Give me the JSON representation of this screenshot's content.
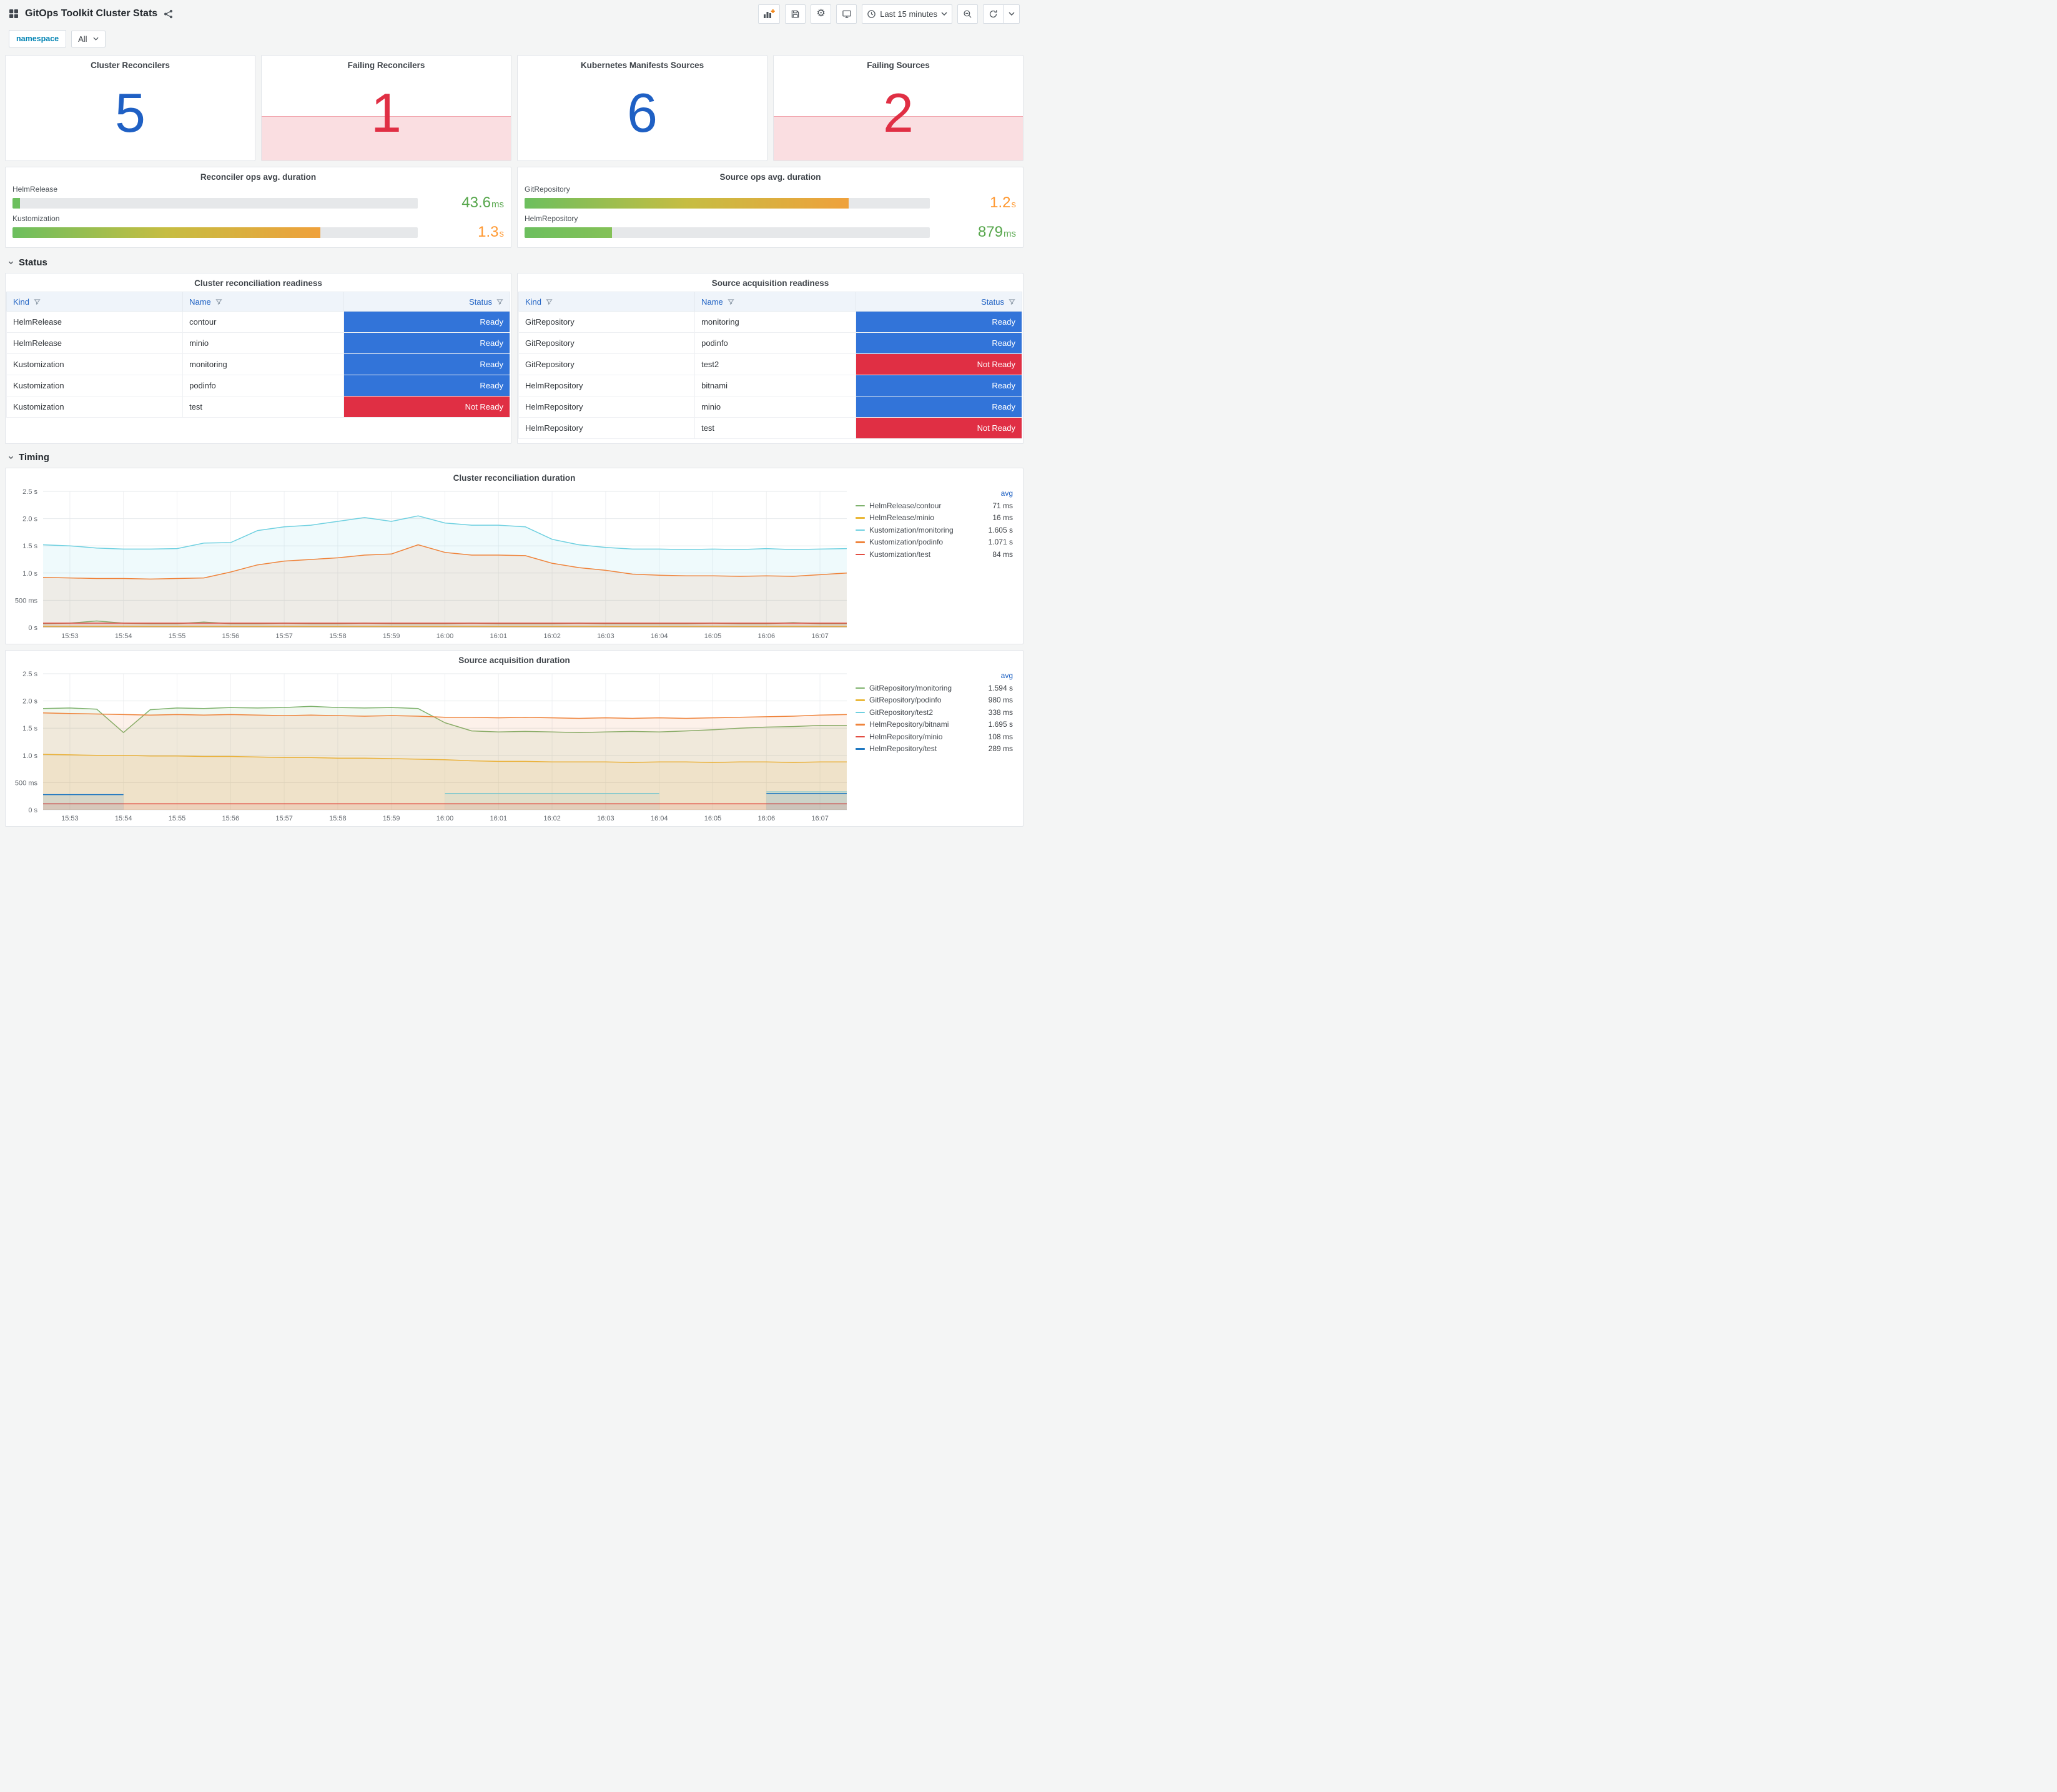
{
  "header": {
    "title": "GitOps Toolkit Cluster Stats",
    "time_picker_label": "Last 15 minutes"
  },
  "variables": {
    "label": "namespace",
    "value": "All"
  },
  "colors": {
    "stat_blue": "#1F60C4",
    "stat_red": "#E02F44",
    "ready": "#3274D9",
    "not_ready": "#E02F44",
    "alert_region": "rgba(224,47,68,0.16)"
  },
  "stat_panels": [
    {
      "title": "Cluster Reconcilers",
      "value": "5",
      "alert": false
    },
    {
      "title": "Failing Reconcilers",
      "value": "1",
      "alert": true
    },
    {
      "title": "Kubernetes Manifests Sources",
      "value": "6",
      "alert": false
    },
    {
      "title": "Failing Sources",
      "value": "2",
      "alert": true
    }
  ],
  "gauge_panels": [
    {
      "title": "Reconciler ops avg. duration",
      "rows": [
        {
          "label": "HelmRelease",
          "value": "43.6",
          "unit": "ms",
          "pct": 1.8,
          "value_color": "#56A64B",
          "bar": [
            "#6CBF5E"
          ]
        },
        {
          "label": "Kustomization",
          "value": "1.3",
          "unit": "s",
          "pct": 76,
          "value_color": "#FF9830",
          "bar": [
            "#6CBF5E",
            "#C6BD42",
            "#EFA13C"
          ]
        }
      ]
    },
    {
      "title": "Source ops avg. duration",
      "rows": [
        {
          "label": "GitRepository",
          "value": "1.2",
          "unit": "s",
          "pct": 80,
          "value_color": "#FF9830",
          "bar": [
            "#6CBF5E",
            "#C6BD42",
            "#EFA13C"
          ]
        },
        {
          "label": "HelmRepository",
          "value": "879",
          "unit": "ms",
          "pct": 21.5,
          "value_color": "#56A64B",
          "bar": [
            "#6CBF5E",
            "#84C157"
          ]
        }
      ]
    }
  ],
  "sections": {
    "status": "Status",
    "timing": "Timing"
  },
  "status_tables": [
    {
      "title": "Cluster reconciliation readiness",
      "columns": [
        "Kind",
        "Name",
        "Status"
      ],
      "rows": [
        {
          "kind": "HelmRelease",
          "name": "contour",
          "status": "Ready"
        },
        {
          "kind": "HelmRelease",
          "name": "minio",
          "status": "Ready"
        },
        {
          "kind": "Kustomization",
          "name": "monitoring",
          "status": "Ready"
        },
        {
          "kind": "Kustomization",
          "name": "podinfo",
          "status": "Ready"
        },
        {
          "kind": "Kustomization",
          "name": "test",
          "status": "Not Ready"
        }
      ]
    },
    {
      "title": "Source acquisition readiness",
      "columns": [
        "Kind",
        "Name",
        "Status"
      ],
      "rows": [
        {
          "kind": "GitRepository",
          "name": "monitoring",
          "status": "Ready"
        },
        {
          "kind": "GitRepository",
          "name": "podinfo",
          "status": "Ready"
        },
        {
          "kind": "GitRepository",
          "name": "test2",
          "status": "Not Ready"
        },
        {
          "kind": "HelmRepository",
          "name": "bitnami",
          "status": "Ready"
        },
        {
          "kind": "HelmRepository",
          "name": "minio",
          "status": "Ready"
        },
        {
          "kind": "HelmRepository",
          "name": "test",
          "status": "Not Ready"
        }
      ]
    }
  ],
  "chart_data": [
    {
      "type": "line",
      "title": "Cluster reconciliation duration",
      "legend_header": "avg",
      "legend_position": "right",
      "grid": true,
      "ylim": [
        0,
        2.5
      ],
      "y_ticks": [
        {
          "v": 0,
          "label": "0 s"
        },
        {
          "v": 0.5,
          "label": "500 ms"
        },
        {
          "v": 1,
          "label": "1.0 s"
        },
        {
          "v": 1.5,
          "label": "1.5 s"
        },
        {
          "v": 2,
          "label": "2.0 s"
        },
        {
          "v": 2.5,
          "label": "2.5 s"
        }
      ],
      "x_range": [
        52.5,
        67.5
      ],
      "x_start": 52.5,
      "x_step": 0.5,
      "x_ticks": [
        {
          "v": 53,
          "label": "15:53"
        },
        {
          "v": 54,
          "label": "15:54"
        },
        {
          "v": 55,
          "label": "15:55"
        },
        {
          "v": 56,
          "label": "15:56"
        },
        {
          "v": 57,
          "label": "15:57"
        },
        {
          "v": 58,
          "label": "15:58"
        },
        {
          "v": 59,
          "label": "15:59"
        },
        {
          "v": 60,
          "label": "16:00"
        },
        {
          "v": 61,
          "label": "16:01"
        },
        {
          "v": 62,
          "label": "16:02"
        },
        {
          "v": 63,
          "label": "16:03"
        },
        {
          "v": 64,
          "label": "16:04"
        },
        {
          "v": 65,
          "label": "16:05"
        },
        {
          "v": 66,
          "label": "16:06"
        },
        {
          "v": 67,
          "label": "16:07"
        }
      ],
      "series": [
        {
          "name": "HelmRelease/contour",
          "color": "#7EB26D",
          "avg": "71 ms",
          "values": [
            0.07,
            0.08,
            0.12,
            0.08,
            0.07,
            0.07,
            0.1,
            0.07,
            0.07,
            0.08,
            0.07,
            0.07,
            0.08,
            0.07,
            0.07,
            0.07,
            0.08,
            0.07,
            0.07,
            0.07,
            0.08,
            0.07,
            0.07,
            0.07,
            0.07,
            0.08,
            0.07,
            0.07,
            0.09,
            0.07,
            0.07
          ]
        },
        {
          "name": "HelmRelease/minio",
          "color": "#EAB839",
          "avg": "16 ms",
          "values": [
            0.02,
            0.02,
            0.02,
            0.02,
            0.02,
            0.02,
            0.02,
            0.02,
            0.02,
            0.02,
            0.02,
            0.02,
            0.02,
            0.02,
            0.02,
            0.02,
            0.02,
            0.02,
            0.02,
            0.02,
            0.02,
            0.02,
            0.02,
            0.02,
            0.02,
            0.02,
            0.02,
            0.02,
            0.02,
            0.02,
            0.02
          ]
        },
        {
          "name": "Kustomization/monitoring",
          "color": "#6ED0E0",
          "avg": "1.605 s",
          "values": [
            1.52,
            1.5,
            1.46,
            1.44,
            1.44,
            1.45,
            1.55,
            1.56,
            1.78,
            1.85,
            1.88,
            1.95,
            2.02,
            1.95,
            2.05,
            1.92,
            1.88,
            1.88,
            1.85,
            1.62,
            1.52,
            1.47,
            1.44,
            1.44,
            1.43,
            1.44,
            1.43,
            1.45,
            1.43,
            1.44,
            1.45
          ]
        },
        {
          "name": "Kustomization/podinfo",
          "color": "#EF843C",
          "avg": "1.071 s",
          "values": [
            0.92,
            0.91,
            0.9,
            0.9,
            0.89,
            0.9,
            0.91,
            1.02,
            1.15,
            1.22,
            1.25,
            1.28,
            1.33,
            1.35,
            1.52,
            1.38,
            1.33,
            1.33,
            1.32,
            1.18,
            1.1,
            1.05,
            0.98,
            0.96,
            0.95,
            0.95,
            0.94,
            0.95,
            0.94,
            0.97,
            1.0
          ]
        },
        {
          "name": "Kustomization/test",
          "color": "#E24D42",
          "avg": "84 ms",
          "values": [
            0.08,
            0.08,
            0.08,
            0.08,
            0.08,
            0.08,
            0.08,
            0.08,
            0.08,
            0.08,
            0.08,
            0.08,
            0.08,
            0.08,
            0.08,
            0.08,
            0.08,
            0.08,
            0.08,
            0.08,
            0.08,
            0.08,
            0.08,
            0.08,
            0.08,
            0.08,
            0.08,
            0.08,
            0.08,
            0.08,
            0.08
          ]
        }
      ]
    },
    {
      "type": "line",
      "title": "Source acquisition duration",
      "legend_header": "avg",
      "legend_position": "right",
      "grid": true,
      "ylim": [
        0,
        2.5
      ],
      "y_ticks": [
        {
          "v": 0,
          "label": "0 s"
        },
        {
          "v": 0.5,
          "label": "500 ms"
        },
        {
          "v": 1,
          "label": "1.0 s"
        },
        {
          "v": 1.5,
          "label": "1.5 s"
        },
        {
          "v": 2,
          "label": "2.0 s"
        },
        {
          "v": 2.5,
          "label": "2.5 s"
        }
      ],
      "x_range": [
        52.5,
        67.5
      ],
      "x_start": 52.5,
      "x_step": 0.5,
      "x_ticks": [
        {
          "v": 53,
          "label": "15:53"
        },
        {
          "v": 54,
          "label": "15:54"
        },
        {
          "v": 55,
          "label": "15:55"
        },
        {
          "v": 56,
          "label": "15:56"
        },
        {
          "v": 57,
          "label": "15:57"
        },
        {
          "v": 58,
          "label": "15:58"
        },
        {
          "v": 59,
          "label": "15:59"
        },
        {
          "v": 60,
          "label": "16:00"
        },
        {
          "v": 61,
          "label": "16:01"
        },
        {
          "v": 62,
          "label": "16:02"
        },
        {
          "v": 63,
          "label": "16:03"
        },
        {
          "v": 64,
          "label": "16:04"
        },
        {
          "v": 65,
          "label": "16:05"
        },
        {
          "v": 66,
          "label": "16:06"
        },
        {
          "v": 67,
          "label": "16:07"
        }
      ],
      "series": [
        {
          "name": "GitRepository/monitoring",
          "color": "#7EB26D",
          "avg": "1.594 s",
          "values": [
            1.86,
            1.87,
            1.85,
            1.42,
            1.84,
            1.87,
            1.86,
            1.88,
            1.87,
            1.88,
            1.9,
            1.88,
            1.87,
            1.88,
            1.86,
            1.6,
            1.45,
            1.43,
            1.44,
            1.43,
            1.42,
            1.43,
            1.44,
            1.43,
            1.45,
            1.47,
            1.5,
            1.52,
            1.53,
            1.55,
            1.55
          ]
        },
        {
          "name": "GitRepository/podinfo",
          "color": "#EAB839",
          "avg": "980 ms",
          "values": [
            1.02,
            1.01,
            1.0,
            1.0,
            0.99,
            0.99,
            0.98,
            0.98,
            0.97,
            0.96,
            0.96,
            0.95,
            0.95,
            0.94,
            0.93,
            0.92,
            0.9,
            0.89,
            0.89,
            0.88,
            0.88,
            0.88,
            0.87,
            0.88,
            0.88,
            0.87,
            0.88,
            0.88,
            0.87,
            0.88,
            0.88
          ]
        },
        {
          "name": "GitRepository/test2",
          "color": "#6ED0E0",
          "avg": "338 ms",
          "values": [
            null,
            null,
            null,
            null,
            null,
            null,
            null,
            null,
            null,
            null,
            null,
            null,
            null,
            null,
            null,
            0.3,
            0.3,
            0.3,
            0.3,
            0.3,
            0.3,
            0.3,
            0.3,
            0.3,
            null,
            null,
            null,
            0.33,
            0.33,
            0.33,
            0.33
          ]
        },
        {
          "name": "HelmRepository/bitnami",
          "color": "#EF843C",
          "avg": "1.695 s",
          "values": [
            1.78,
            1.77,
            1.76,
            1.75,
            1.74,
            1.75,
            1.74,
            1.75,
            1.74,
            1.73,
            1.74,
            1.73,
            1.72,
            1.73,
            1.72,
            1.7,
            1.7,
            1.69,
            1.7,
            1.69,
            1.68,
            1.69,
            1.68,
            1.69,
            1.68,
            1.69,
            1.7,
            1.71,
            1.72,
            1.74,
            1.75
          ]
        },
        {
          "name": "HelmRepository/minio",
          "color": "#E24D42",
          "avg": "108 ms",
          "values": [
            0.11,
            0.11,
            0.11,
            0.11,
            0.11,
            0.11,
            0.11,
            0.11,
            0.11,
            0.11,
            0.11,
            0.11,
            0.11,
            0.11,
            0.11,
            0.11,
            0.11,
            0.11,
            0.11,
            0.11,
            0.11,
            0.11,
            0.11,
            0.11,
            0.11,
            0.11,
            0.11,
            0.11,
            0.11,
            0.11,
            0.11
          ]
        },
        {
          "name": "HelmRepository/test",
          "color": "#1F78C1",
          "avg": "289 ms",
          "values": [
            0.28,
            0.28,
            0.28,
            0.28,
            null,
            null,
            null,
            null,
            null,
            null,
            null,
            null,
            null,
            null,
            null,
            null,
            null,
            null,
            null,
            null,
            null,
            null,
            null,
            null,
            null,
            null,
            null,
            0.3,
            0.3,
            0.3,
            0.3
          ]
        }
      ]
    }
  ]
}
